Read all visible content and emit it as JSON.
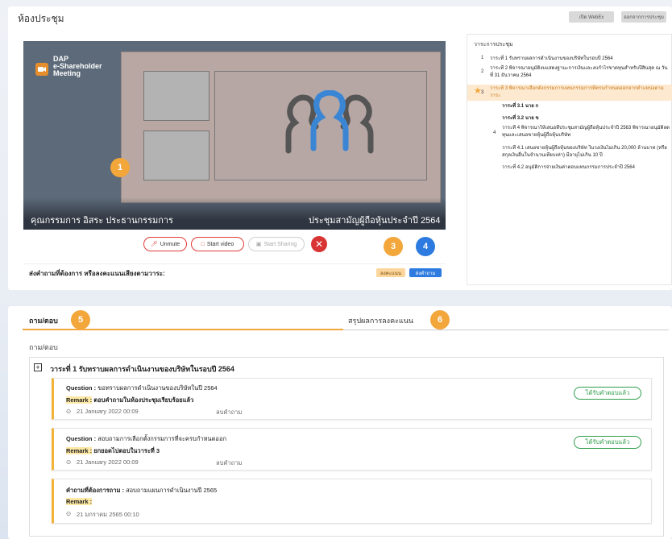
{
  "header": {
    "title": "ห้องประชุม",
    "open_webex_label": "เปิด WebEx",
    "leave_meeting_label": "ออกจากการประชุม"
  },
  "video": {
    "logo_line1": "DAP",
    "logo_line2": "e-Shareholder",
    "logo_line3": "Meeting",
    "speaker_caption": "คุณกรรมการ อิสระ ประธานกรรมการ",
    "meeting_caption": "ประชุมสามัญผู้ถือหุ้นประจำปี 2564",
    "controls": {
      "unmute": "Unmute",
      "start_video": "Start video",
      "start_sharing": "Start Sharing",
      "close": "✕"
    }
  },
  "ask_bar": {
    "label": "ส่งคำถามที่ต้องการ หรือลงคะแนนเสียงตามวาระ:",
    "vote_label": "ลงคะแนน",
    "ask_label": "ส่งคำถาม"
  },
  "badges": [
    "1",
    "2",
    "3",
    "4",
    "5",
    "6"
  ],
  "agenda": {
    "title": "วาระการประชุม",
    "items": [
      {
        "num": "1",
        "text": "วาระที่ 1 รับทราบผลการดำเนินงานของบริษัทในรอบปี 2564"
      },
      {
        "num": "2",
        "text": "วาระที่ 2 พิจารณาอนุมัติงบแสดงฐานะการเงินและงบกำไรขาดทุนสำหรับปีสิ้นสุด ณ วันที่ 31 ธันวาคม 2564"
      },
      {
        "num": "3",
        "text": "วาระที่ 3 พิจารณาเลือกตั้งกรรมการแทนกรรมการที่ครบกำหนดออกจากตำแหน่งตามวาระ"
      },
      {
        "num": "",
        "text": "วาระที่ 3.1  นาย ก"
      },
      {
        "num": "",
        "text": "วาระที่ 3.2  นาย ข"
      },
      {
        "num": "4",
        "text": "วาระที่ 4 พิจารณาให้เสนอที่ประชุมสามัญผู้ถือหุ้นประจำปี 2563 พิจารณาอนุมัติลดทุนและเสนอขายหุ้นผู้ถือหุ้นบริษัท"
      },
      {
        "num": "",
        "text": "วาระที่ 4.1 เสนอขายหุ้นผู้ถือหุ้นของบริษัท ในวงเงินไม่เกิน 20,000 ล้านบาท (หรือสกุลเงินอื่นในจำนวนเทียบเท่า) มีอายุไม่เกิน 10 ปี"
      },
      {
        "num": "",
        "text": "วาระที่ 4.2 อนุมัติการจ่ายเงินค่าตอบแทนกรรมการประจำปี 2564"
      }
    ]
  },
  "tabs": {
    "qa": "ถาม/ตอบ",
    "vote_summary": "สรุปผลการลงคะแนน"
  },
  "qa": {
    "section_label": "ถาม/ตอบ",
    "group_title": "วาระที่ 1 รับทราบผลการดำเนินงานของบริษัทในรอบปี 2564",
    "expand_symbol": "+",
    "cards": [
      {
        "q_label": "Question :",
        "q_text": "ขอทราบผลการดำเนินงานของบริษัทในปี 2564",
        "remark_label": "Remark :",
        "remark_text": "ตอบคำถามในห้องประชุมเรียบร้อยแล้ว",
        "time": "21 January 2022 00:09",
        "delete": "ลบคำถาม",
        "status": "ได้รับคำตอบแล้ว"
      },
      {
        "q_label": "Question :",
        "q_text": "สอบถามการเลือกตั้งกรรมการที่จะครบกำหนดออก",
        "remark_label": "Remark :",
        "remark_text": "ยกยอดไปตอบในวาระที่ 3",
        "time": "21 January 2022 00:09",
        "delete": "ลบคำถาม",
        "status": "ได้รับคำตอบแล้ว"
      },
      {
        "q_label": "คำถามที่ต้องการถาม :",
        "q_text": "สอบถามแผนการดำเนินงานปี 2565",
        "remark_label": "Remark :",
        "remark_text": "",
        "time": "21 มกราคม 2565 00:10",
        "delete": "",
        "status": ""
      }
    ]
  },
  "colors": {
    "accent_orange": "#f3a63a",
    "accent_blue": "#2d7be0",
    "answered_green": "#2e9c4a",
    "danger_red": "#d93434"
  }
}
